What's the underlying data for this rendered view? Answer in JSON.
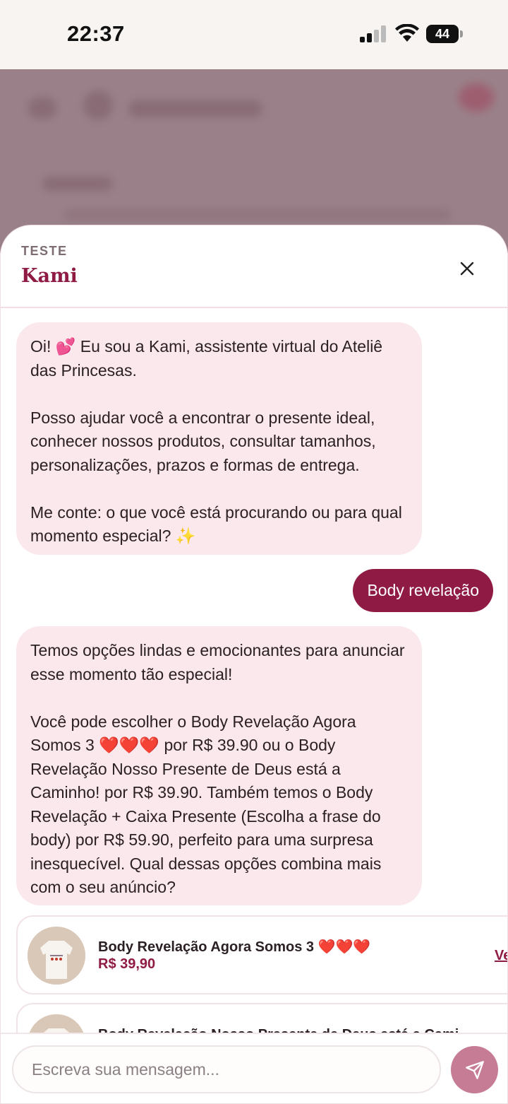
{
  "status_bar": {
    "time": "22:37",
    "battery_level": "44"
  },
  "sheet": {
    "subtitle": "TESTE",
    "title": "Kami",
    "close_icon": "close-icon"
  },
  "messages": [
    {
      "role": "bot",
      "text": "Oi! 💕 Eu sou a Kami, assistente virtual do Ateliê das Princesas.\n\nPosso ajudar você a encontrar o presente ideal, conhecer nossos produtos, consultar tamanhos, personalizações, prazos e formas de entrega.\n\nMe conte: o que você está procurando ou para qual momento especial? ✨"
    },
    {
      "role": "user",
      "text": "Body revelação"
    },
    {
      "role": "bot",
      "text": "Temos opções lindas e emocionantes para anunciar esse momento tão especial!\n\nVocê pode escolher o Body Revelação Agora Somos 3 ❤️❤️❤️ por R$ 39.90 ou o Body Revelação Nosso Presente de Deus está a Caminho! por R$ 39.90. Também temos o Body Revelação + Caixa Presente (Escolha a frase do body) por R$ 59.90, perfeito para uma surpresa inesquecível. Qual dessas opções combina mais com o seu anúncio?"
    }
  ],
  "products": [
    {
      "name": "Body Revelação Agora Somos 3 ❤️❤️❤️",
      "price": "R$ 39,90",
      "link_label": "Ve"
    },
    {
      "name": "Body Revelação Nosso Presente de Deus está a Cami",
      "price": "",
      "link_label": ""
    }
  ],
  "composer": {
    "placeholder": "Escreva sua mensagem...",
    "send_icon": "send-icon"
  },
  "colors": {
    "brand": "#8f1b45",
    "bot_bubble": "#fbe8ec",
    "send_button": "#c77c96"
  }
}
